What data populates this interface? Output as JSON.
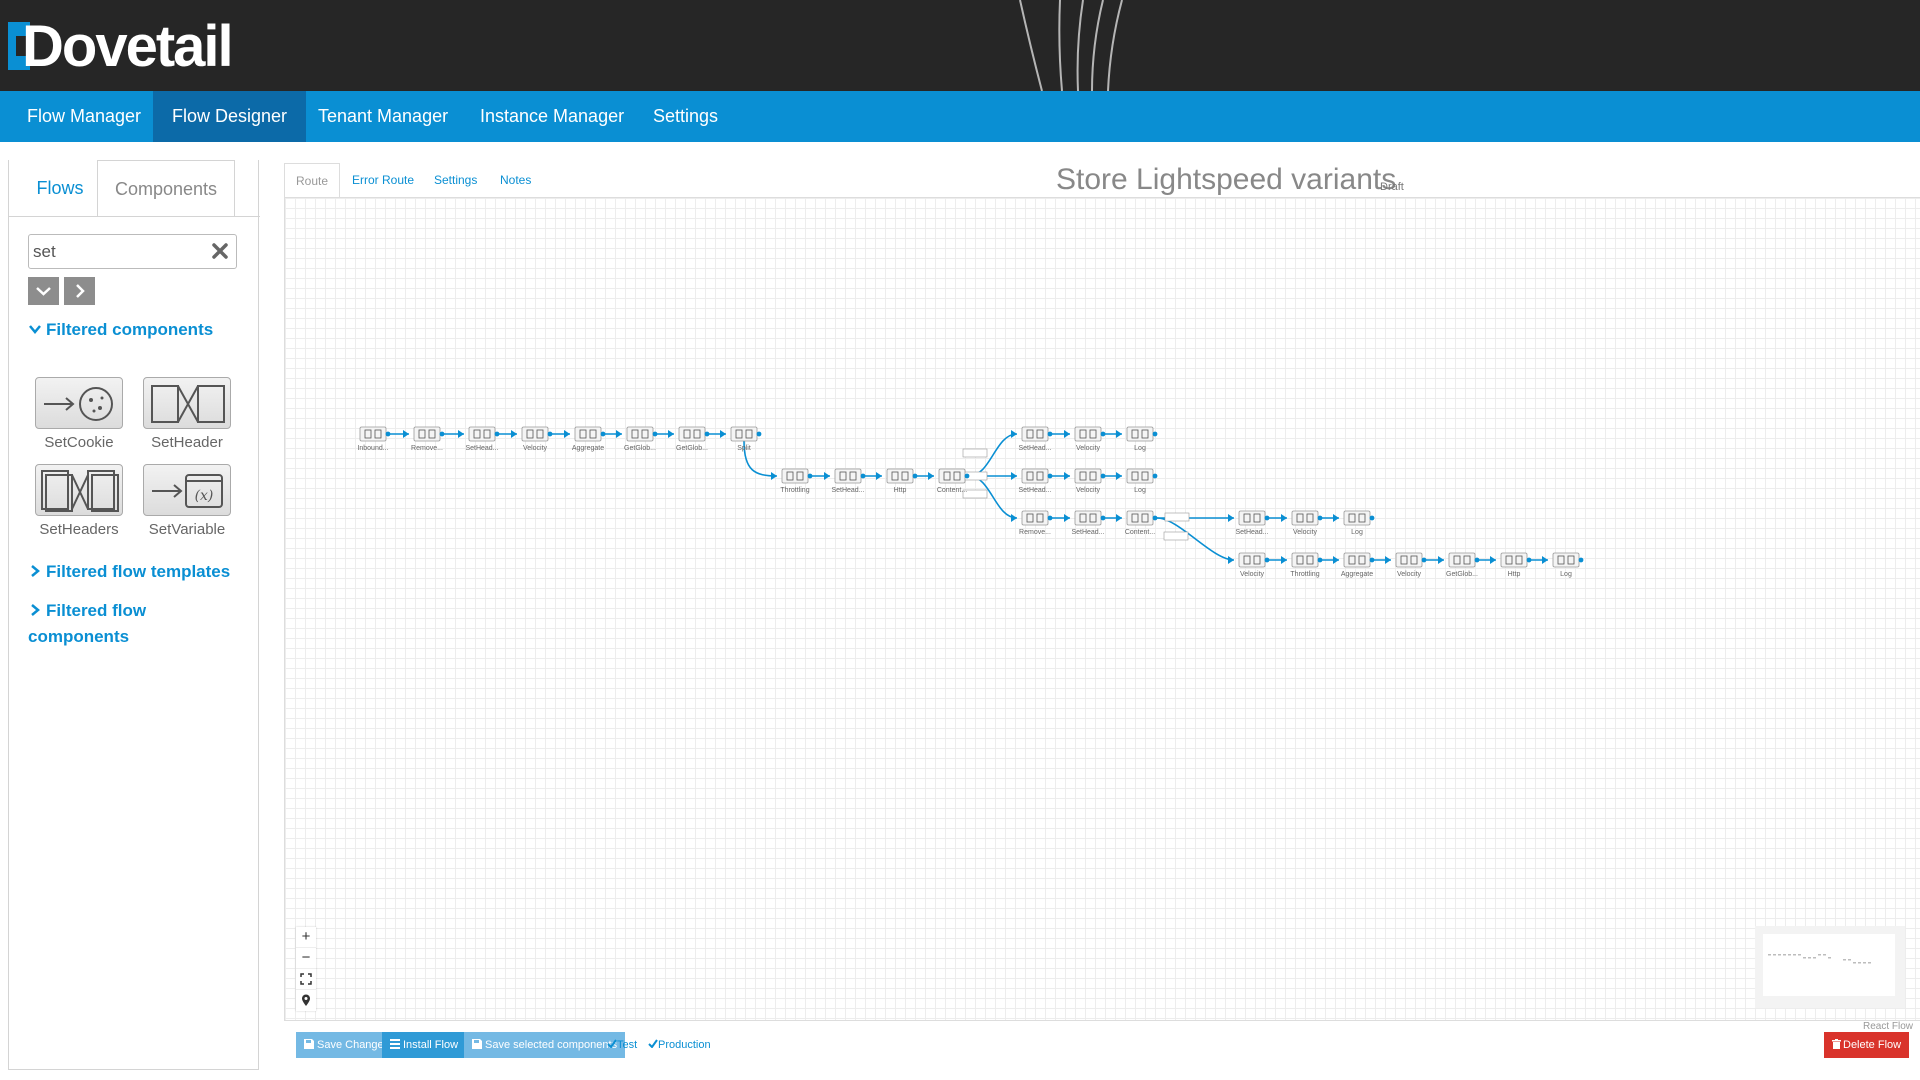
{
  "app": {
    "logo_text": "Dovetail"
  },
  "nav": {
    "items": [
      {
        "label": "Flow Manager"
      },
      {
        "label": "Flow Designer",
        "active": true
      },
      {
        "label": "Tenant Manager"
      },
      {
        "label": "Instance Manager"
      },
      {
        "label": "Settings"
      }
    ]
  },
  "sidebar": {
    "tabs": {
      "flows": "Flows",
      "components": "Components",
      "active": "Components"
    },
    "search": {
      "value": "set",
      "placeholder": ""
    },
    "sections": {
      "filtered_components": "Filtered components",
      "filtered_flow_templates": "Filtered flow templates",
      "filtered_flow_components": "Filtered flow components"
    },
    "components": [
      {
        "label": "SetCookie",
        "icon": "set-cookie-icon"
      },
      {
        "label": "SetHeader",
        "icon": "set-header-icon"
      },
      {
        "label": "SetHeaders",
        "icon": "set-headers-icon"
      },
      {
        "label": "SetVariable",
        "icon": "set-variable-icon"
      }
    ]
  },
  "designer": {
    "tabs": {
      "route": "Route",
      "error_route": "Error Route",
      "settings": "Settings",
      "notes": "Notes",
      "active": "Route"
    },
    "flow_title": "Store Lightspeed variants",
    "flow_status": "Draft",
    "attribution": "React Flow",
    "flow": {
      "nodes": [
        {
          "id": "n1",
          "label": "Inbound..."
        },
        {
          "id": "n2",
          "label": "Remove..."
        },
        {
          "id": "n3",
          "label": "SetHead..."
        },
        {
          "id": "n4",
          "label": "Velocity"
        },
        {
          "id": "n5",
          "label": "Aggregate"
        },
        {
          "id": "n6",
          "label": "GetGlob..."
        },
        {
          "id": "n7",
          "label": "GetGlob..."
        },
        {
          "id": "n8",
          "label": "Split"
        },
        {
          "id": "n9",
          "label": "Throttling"
        },
        {
          "id": "n10",
          "label": "SetHead..."
        },
        {
          "id": "n11",
          "label": "Http"
        },
        {
          "id": "n12",
          "label": "Content..."
        },
        {
          "id": "n13",
          "label": "SetHead..."
        },
        {
          "id": "n14",
          "label": "Velocity"
        },
        {
          "id": "n15",
          "label": "Log"
        },
        {
          "id": "n16",
          "label": "SetHead..."
        },
        {
          "id": "n17",
          "label": "Velocity"
        },
        {
          "id": "n18",
          "label": "Log"
        },
        {
          "id": "n19",
          "label": "Remove..."
        },
        {
          "id": "n20",
          "label": "SetHead..."
        },
        {
          "id": "n21",
          "label": "Content..."
        },
        {
          "id": "n22",
          "label": "SetHead..."
        },
        {
          "id": "n23",
          "label": "Velocity"
        },
        {
          "id": "n24",
          "label": "Log"
        },
        {
          "id": "n25",
          "label": "Velocity"
        },
        {
          "id": "n26",
          "label": "Throttling"
        },
        {
          "id": "n27",
          "label": "Aggregate"
        },
        {
          "id": "n28",
          "label": "Velocity"
        },
        {
          "id": "n29",
          "label": "GetGlob..."
        },
        {
          "id": "n30",
          "label": "Http"
        },
        {
          "id": "n31",
          "label": "Log"
        }
      ]
    }
  },
  "actions": {
    "save_changes": "Save Changes",
    "install_flow": "Install Flow",
    "save_selected": "Save selected components",
    "test": "Test",
    "production": "Production",
    "delete_flow": "Delete Flow"
  },
  "colors": {
    "brand": "#0a8fd3",
    "nav_active": "#0c6aa8",
    "header_bg": "#262626",
    "danger": "#d9332b"
  }
}
